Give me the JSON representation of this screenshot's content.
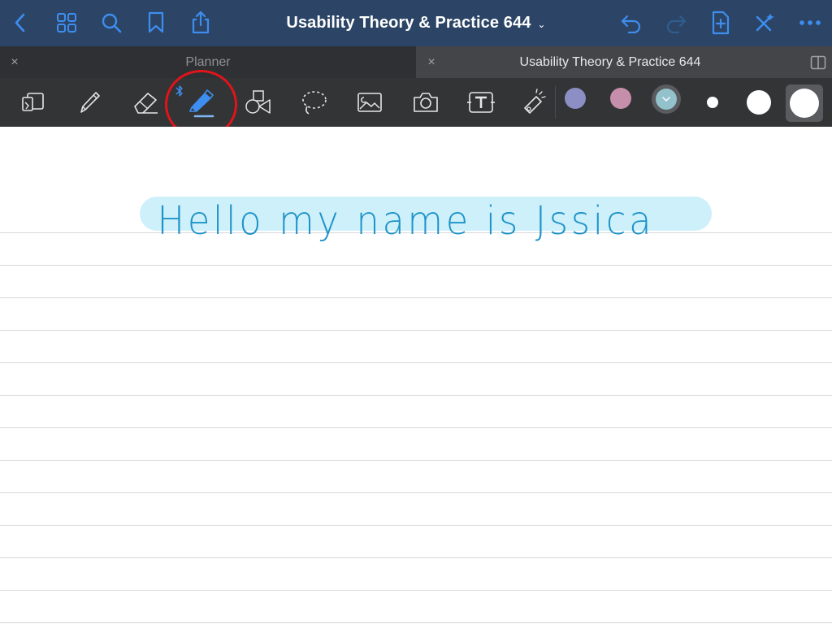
{
  "navbar": {
    "title": "Usability Theory & Practice 644",
    "title_chevron": "⌄",
    "buttons": {
      "left": [
        "back-icon",
        "grid-icon",
        "search-icon",
        "bookmark-icon",
        "share-icon"
      ],
      "right": [
        "undo-icon",
        "redo-icon",
        "add-page-icon",
        "tools-close-icon",
        "more-icon"
      ]
    },
    "accent_color": "#3d8ef0",
    "background": "#2c4566"
  },
  "tabs": [
    {
      "label": "Planner",
      "active": false,
      "close": "×"
    },
    {
      "label": "Usability Theory & Practice 644",
      "active": true,
      "close": "×"
    }
  ],
  "toolbar": {
    "tools": [
      {
        "name": "read-mode-icon"
      },
      {
        "name": "pen-icon"
      },
      {
        "name": "eraser-icon"
      },
      {
        "name": "highlighter-icon",
        "selected": true
      },
      {
        "name": "shapes-icon"
      },
      {
        "name": "lasso-icon"
      },
      {
        "name": "image-icon"
      },
      {
        "name": "camera-icon"
      },
      {
        "name": "text-icon"
      },
      {
        "name": "laser-pointer-icon"
      }
    ],
    "colors": [
      "#8b8fc4",
      "#c58fab",
      "#93c2cc"
    ],
    "selected_color": "#93c2cc",
    "stroke_sizes": [
      "small",
      "medium",
      "large"
    ],
    "selected_size": "large",
    "bluetooth_indicator": "bluetooth-icon",
    "annotation_circle_color": "#e0141b"
  },
  "page": {
    "handwritten_text": "Hello my name is Jssica",
    "ink_color": "#1e93c8",
    "highlight_color": "#cdf0fa"
  }
}
